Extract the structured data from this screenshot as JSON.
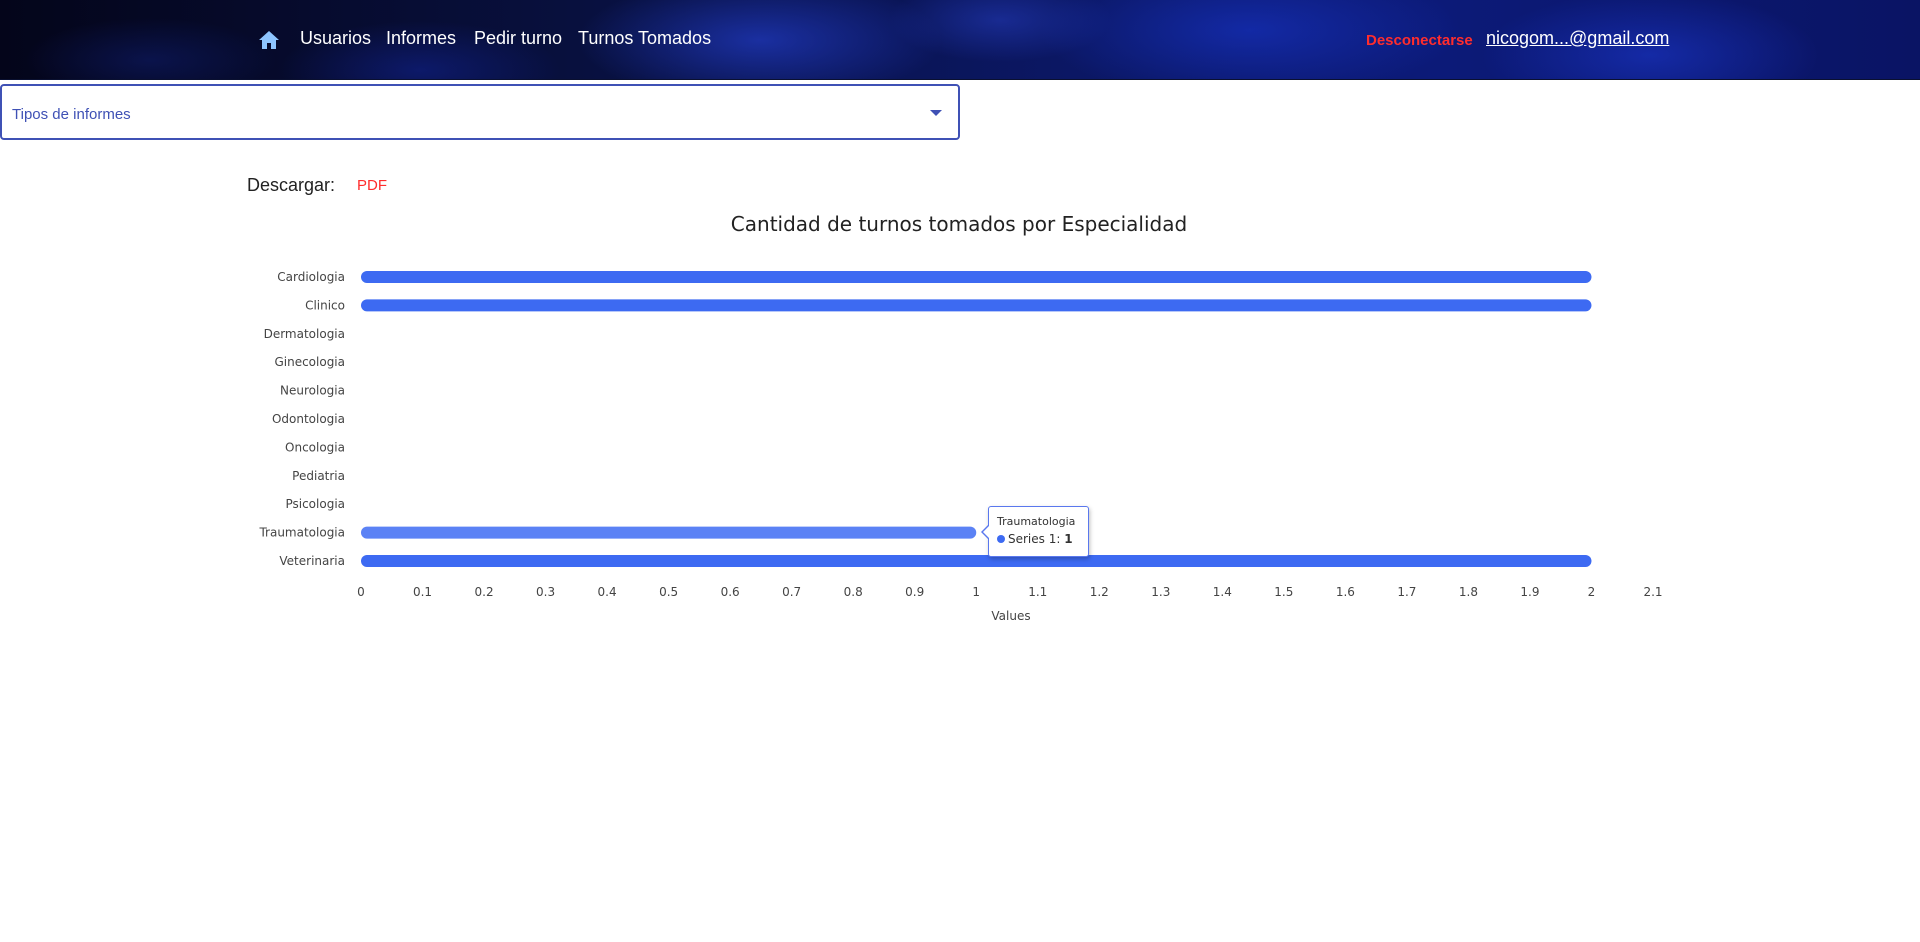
{
  "nav": {
    "items": [
      "Usuarios",
      "Informes",
      "Pedir turno",
      "Turnos Tomados"
    ],
    "logout_label": "Desconectarse",
    "user_email": "nicogom...@gmail.com"
  },
  "select": {
    "label": "Tipos de informes"
  },
  "download": {
    "label": "Descargar:",
    "pdf_label": "PDF"
  },
  "colors": {
    "bar": "#3d6af2",
    "bar_highlight": "#5b82f5",
    "logout": "#ff2d2d",
    "accent": "#3f51b5"
  },
  "chart_data": {
    "type": "bar",
    "orientation": "horizontal",
    "title": "Cantidad de turnos tomados por Especialidad",
    "xlabel": "Values",
    "ylabel": "",
    "categories": [
      "Cardiologia",
      "Clinico",
      "Dermatologia",
      "Ginecologia",
      "Neurologia",
      "Odontologia",
      "Oncologia",
      "Pediatria",
      "Psicologia",
      "Traumatologia",
      "Veterinaria"
    ],
    "series": [
      {
        "name": "Series 1",
        "values": [
          2,
          2,
          0,
          0,
          0,
          0,
          0,
          0,
          0,
          1,
          2
        ]
      }
    ],
    "xlim": [
      0,
      2.1
    ],
    "xticks": [
      "0",
      "0.1",
      "0.2",
      "0.3",
      "0.4",
      "0.5",
      "0.6",
      "0.7",
      "0.8",
      "0.9",
      "1",
      "1.1",
      "1.2",
      "1.3",
      "1.4",
      "1.5",
      "1.6",
      "1.7",
      "1.8",
      "1.9",
      "2",
      "2.1"
    ],
    "grid": false,
    "tooltip": {
      "category": "Traumatologia",
      "series": "Series 1",
      "value": "1"
    }
  }
}
